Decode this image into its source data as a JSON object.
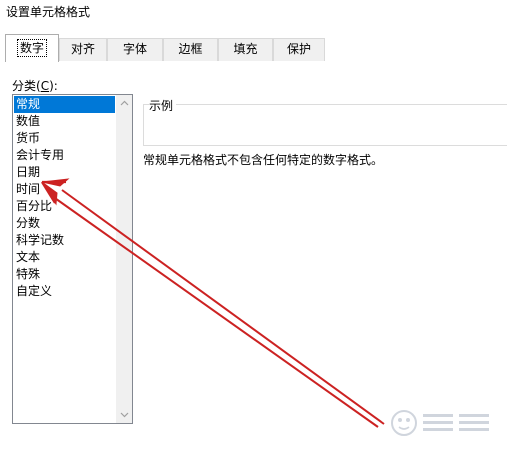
{
  "dialog": {
    "title": "设置单元格格式"
  },
  "tabs": [
    {
      "label": "数字",
      "active": true
    },
    {
      "label": "对齐",
      "active": false
    },
    {
      "label": "字体",
      "active": false
    },
    {
      "label": "边框",
      "active": false
    },
    {
      "label": "填充",
      "active": false
    },
    {
      "label": "保护",
      "active": false
    }
  ],
  "category": {
    "label_prefix": "分类(",
    "label_key": "C",
    "label_suffix": "):",
    "items": [
      "常规",
      "数值",
      "货币",
      "会计专用",
      "日期",
      "时间",
      "百分比",
      "分数",
      "科学记数",
      "文本",
      "特殊",
      "自定义"
    ],
    "selected": "常规"
  },
  "sample": {
    "label": "示例",
    "value": ""
  },
  "description": "常规单元格格式不包含任何特定的数字格式。",
  "annotation": {
    "color": "#cc2222",
    "points_to": "日期"
  },
  "colors": {
    "selection": "#0078d7",
    "tab_background": "#f0f0f0"
  },
  "icons": {
    "scroll_up": "chevron-up-icon",
    "scroll_down": "chevron-down-icon"
  }
}
